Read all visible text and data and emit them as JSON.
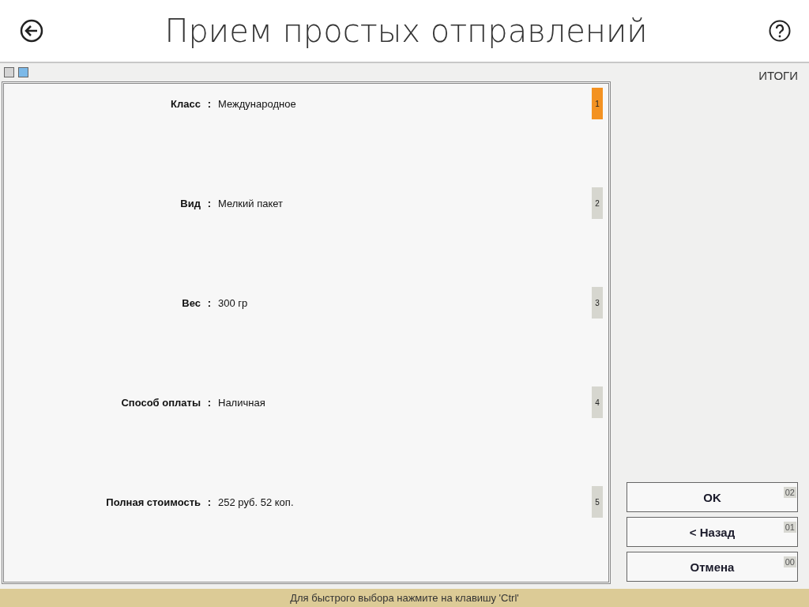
{
  "header": {
    "title": "Прием простых отправлений"
  },
  "indicators": [
    {
      "color": "#d4d4d4"
    },
    {
      "color": "#7cb9e8"
    }
  ],
  "fields": [
    {
      "label": "Класс",
      "separator": ":",
      "value": "Международное",
      "key": "1",
      "selected": true
    },
    {
      "label": "Вид",
      "separator": ":",
      "value": "Мелкий пакет",
      "key": "2",
      "selected": false
    },
    {
      "label": "Вес",
      "separator": ":",
      "value": "300 гр",
      "key": "3",
      "selected": false
    },
    {
      "label": "Способ оплаты",
      "separator": ":",
      "value": "Наличная",
      "key": "4",
      "selected": false
    },
    {
      "label": "Полная стоимость",
      "separator": ":",
      "value": "252 руб. 52 коп.",
      "key": "5",
      "selected": false
    }
  ],
  "summary": {
    "title": "ИТОГИ"
  },
  "buttons": [
    {
      "label": "OK",
      "shortcut": "02"
    },
    {
      "label": "< Назад",
      "shortcut": "01"
    },
    {
      "label": "Отмена",
      "shortcut": "00"
    }
  ],
  "status_bar": {
    "text": "Для быстрого выбора нажмите на клавишу 'Ctrl'"
  }
}
